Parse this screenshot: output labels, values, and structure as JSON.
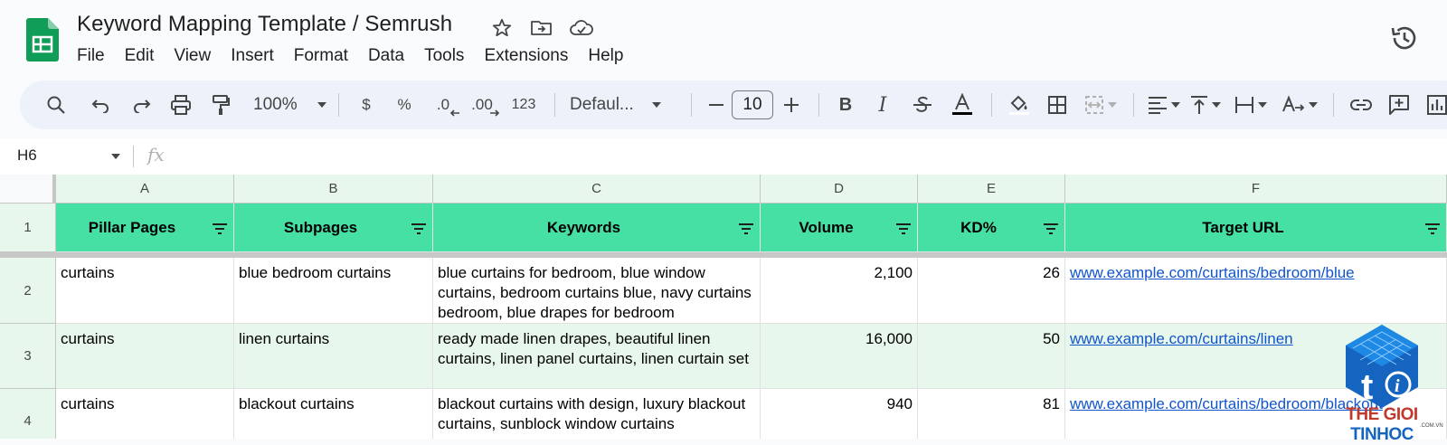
{
  "title_bar": {
    "doc_title": "Keyword Mapping Template / Semrush",
    "menu": [
      "File",
      "Edit",
      "View",
      "Insert",
      "Format",
      "Data",
      "Tools",
      "Extensions",
      "Help"
    ]
  },
  "toolbar": {
    "zoom": "100%",
    "currency": "$",
    "percent": "%",
    "decrease_decimal": ".0",
    "increase_decimal": ".00",
    "number_format": "123",
    "font": "Defaul...",
    "font_size": "10"
  },
  "formula_bar": {
    "name_box": "H6",
    "fx": "fx",
    "value": ""
  },
  "grid": {
    "column_letters": [
      "A",
      "B",
      "C",
      "D",
      "E",
      "F"
    ],
    "row_numbers": [
      "1",
      "2",
      "3",
      "4"
    ],
    "headers": [
      "Pillar Pages",
      "Subpages",
      "Keywords",
      "Volume",
      "KD%",
      "Target URL"
    ],
    "rows": [
      {
        "pillar": "curtains",
        "subpage": "blue bedroom curtains",
        "keywords": "blue curtains for bedroom, blue window curtains, bedroom curtains blue, navy curtains bedroom, blue drapes for bedroom",
        "volume": "2,100",
        "kd": "26",
        "url": "www.example.com/curtains/bedroom/blue"
      },
      {
        "pillar": "curtains",
        "subpage": "linen curtains",
        "keywords": "ready made linen drapes, beautiful linen curtains, linen panel curtains, linen curtain set",
        "volume": "16,000",
        "kd": "50",
        "url": "www.example.com/curtains/linen"
      },
      {
        "pillar": "curtains",
        "subpage": "blackout curtains",
        "keywords": "blackout curtains with design, luxury blackout curtains, sunblock window curtains",
        "volume": "940",
        "kd": "81",
        "url": "www.example.com/curtains/bedroom/blackout"
      }
    ]
  },
  "watermark": {
    "brand_red": "THE GIOI ",
    "brand_blue": "TINHOC",
    "sub": ".COM.VN"
  },
  "colors": {
    "header_green": "#46e0a5",
    "band_green": "#e8f7ec",
    "link_blue": "#1155cc",
    "sheets_green": "#0f9d58"
  }
}
